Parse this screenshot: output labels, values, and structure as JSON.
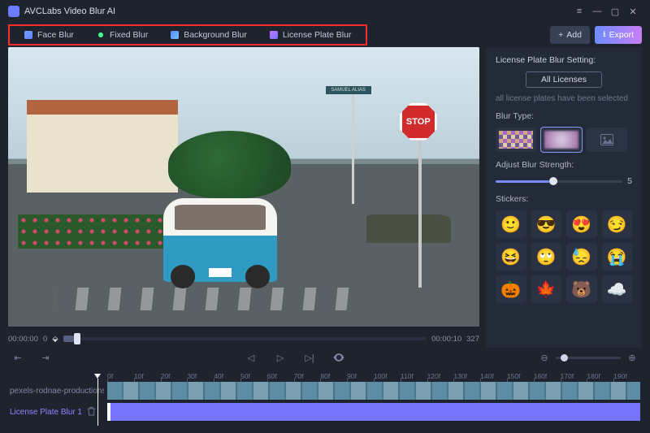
{
  "app": {
    "title": "AVCLabs Video Blur AI"
  },
  "toolbar": {
    "tabs": {
      "face": "Face Blur",
      "fixed": "Fixed Blur",
      "background": "Background Blur",
      "license_plate": "License Plate Blur"
    },
    "add_label": "Add",
    "export_label": "Export"
  },
  "video": {
    "street_sign": "SAMUEL ALIAS",
    "stop_sign": "STOP",
    "time_current": "00:00:00",
    "time_total": "00:00:10",
    "frame_total": "327",
    "frame_current": "0"
  },
  "panel": {
    "title": "License Plate Blur Setting:",
    "all_licenses": "All Licenses",
    "hint": "all license plates have been selected",
    "blur_type_label": "Blur Type:",
    "strength_label": "Adjust Blur Strength:",
    "strength_value": "5",
    "stickers_label": "Stickers:"
  },
  "stickers": [
    "🙂",
    "😎",
    "😍",
    "😏",
    "😆",
    "🙄",
    "😓",
    "😭",
    "🎃",
    "🍁",
    "🐻",
    "☁️"
  ],
  "timeline": {
    "ticks": [
      "0f",
      "10f",
      "20f",
      "30f",
      "40f",
      "50f",
      "60f",
      "70f",
      "80f",
      "90f",
      "100f",
      "110f",
      "120f",
      "130f",
      "140f",
      "150f",
      "160f",
      "170f",
      "180f",
      "190f"
    ],
    "clip_name": "pexels-rodnae-productions-i",
    "blur_track_name": "License Plate Blur 1"
  }
}
